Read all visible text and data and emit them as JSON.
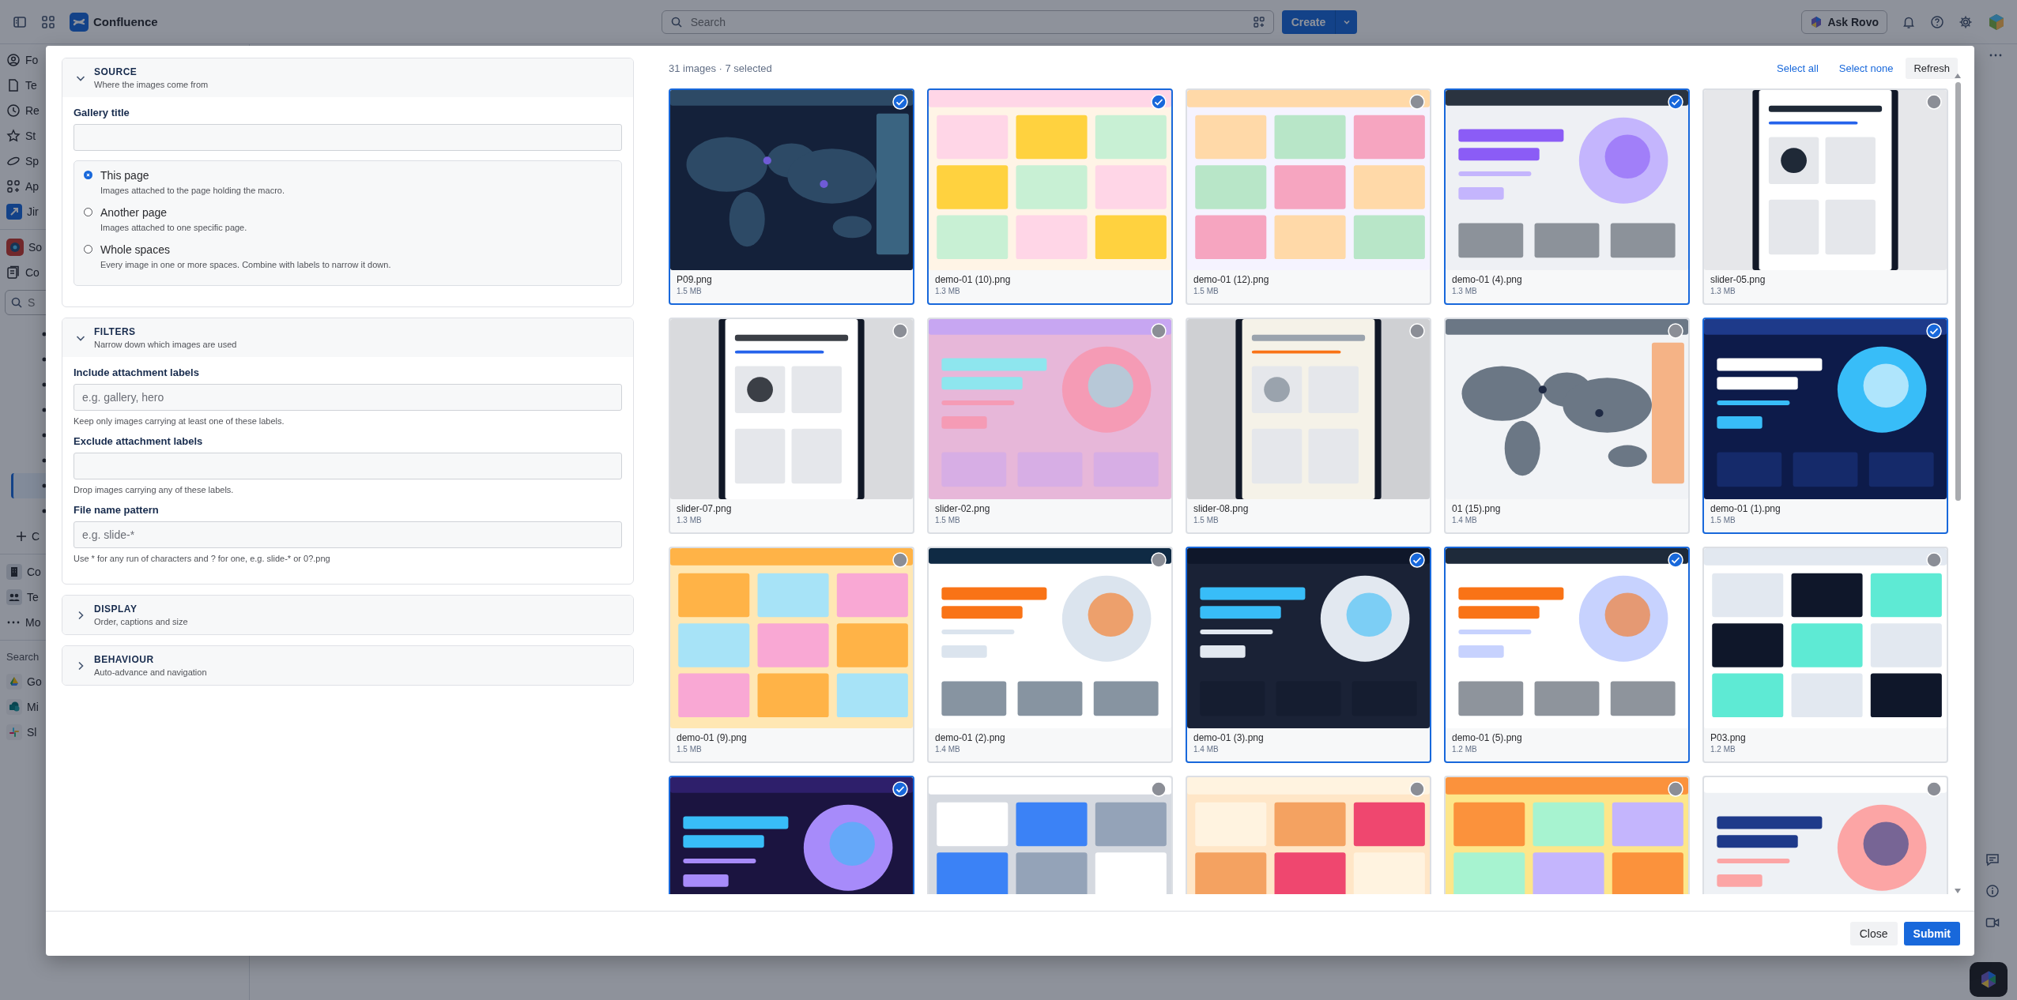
{
  "app": {
    "name": "Confluence"
  },
  "topbar": {
    "search_placeholder": "Search",
    "create_label": "Create",
    "rovo_label": "Ask Rovo"
  },
  "sidebar": {
    "nav": [
      {
        "label": "Fo"
      },
      {
        "label": "Te"
      },
      {
        "label": "Re"
      },
      {
        "label": "St"
      },
      {
        "label": "Sp"
      },
      {
        "label": "Ap"
      },
      {
        "label": "Jir"
      }
    ],
    "space": [
      {
        "label": "So"
      },
      {
        "label": "Co"
      }
    ],
    "search_placeholder": "S",
    "tree": [
      {
        "selected": false
      },
      {
        "selected": false
      },
      {
        "selected": false
      },
      {
        "selected": false
      },
      {
        "selected": false
      },
      {
        "selected": false
      },
      {
        "selected": true
      },
      {
        "selected": false
      }
    ],
    "tree_add": "C",
    "more": [
      {
        "label": "Co"
      },
      {
        "label": "Te"
      },
      {
        "label": "Mo"
      }
    ],
    "apps_heading": "Search",
    "apps": [
      {
        "label": "Go"
      },
      {
        "label": "Mi"
      },
      {
        "label": "Sl"
      }
    ]
  },
  "modal": {
    "sections": [
      {
        "title": "SOURCE",
        "subtitle": "Where the images come from",
        "expanded": true,
        "fields": [
          {
            "kind": "text",
            "label": "Gallery title"
          },
          {
            "kind": "radio",
            "options": [
              {
                "label": "This page",
                "description": "Images attached to the page holding the macro.",
                "selected": true
              },
              {
                "label": "Another page",
                "description": "Images attached to one specific page.",
                "selected": false
              },
              {
                "label": "Whole spaces",
                "description": "Every image in one or more spaces. Combine with labels to narrow it down.",
                "selected": false
              }
            ]
          }
        ]
      },
      {
        "title": "FILTERS",
        "subtitle": "Narrow down which images are used",
        "expanded": true,
        "fields": [
          {
            "kind": "text",
            "label": "Include attachment labels",
            "placeholder": "e.g. gallery, hero",
            "help": "Keep only images carrying at least one of these labels."
          },
          {
            "kind": "text",
            "label": "Exclude attachment labels",
            "help": "Drop images carrying any of these labels."
          },
          {
            "kind": "text",
            "label": "File name pattern",
            "placeholder": "e.g. slide-*",
            "help": "Use * for any run of characters and ? for one, e.g. slide-* or 0?.png"
          }
        ]
      },
      {
        "title": "DISPLAY",
        "subtitle": "Order, captions and size",
        "expanded": false
      },
      {
        "title": "BEHAVIOUR",
        "subtitle": "Auto-advance and navigation",
        "expanded": false
      }
    ],
    "gallery": {
      "summary": "31 images · 7 selected",
      "actions": [
        "Select all",
        "Select none"
      ],
      "refresh": "Refresh",
      "images": [
        {
          "kind": "picture",
          "name": "P09.png",
          "size": "1.5 MB",
          "selected": true
        },
        {
          "kind": "picture",
          "name": "demo-01 (10).png",
          "size": "1.3 MB",
          "selected": true
        },
        {
          "kind": "picture",
          "name": "demo-01 (12).png",
          "size": "1.5 MB",
          "selected": false
        },
        {
          "kind": "picture",
          "name": "demo-01 (4).png",
          "size": "1.3 MB",
          "selected": true
        },
        {
          "kind": "picture",
          "name": "slider-05.png",
          "size": "1.3 MB",
          "selected": false
        },
        {
          "kind": "picture",
          "name": "slider-07.png",
          "size": "1.3 MB",
          "selected": false
        },
        {
          "kind": "picture",
          "name": "slider-02.png",
          "size": "1.5 MB",
          "selected": false
        },
        {
          "kind": "picture",
          "name": "slider-08.png",
          "size": "1.5 MB",
          "selected": false
        },
        {
          "kind": "picture",
          "name": "01 (15).png",
          "size": "1.4 MB",
          "selected": false
        },
        {
          "kind": "picture",
          "name": "demo-01 (1).png",
          "size": "1.5 MB",
          "selected": true
        },
        {
          "kind": "picture",
          "name": "demo-01 (9).png",
          "size": "1.5 MB",
          "selected": false
        },
        {
          "kind": "picture",
          "name": "demo-01 (2).png",
          "size": "1.4 MB",
          "selected": false
        },
        {
          "kind": "picture",
          "name": "demo-01 (3).png",
          "size": "1.4 MB",
          "selected": true
        },
        {
          "kind": "picture",
          "name": "demo-01 (5).png",
          "size": "1.2 MB",
          "selected": true
        },
        {
          "kind": "picture",
          "name": "P03.png",
          "size": "1.2 MB",
          "selected": false
        },
        {
          "kind": "picture",
          "selected": true
        },
        {
          "kind": "picture",
          "selected": false
        },
        {
          "kind": "picture",
          "selected": false
        },
        {
          "kind": "picture",
          "selected": false
        },
        {
          "kind": "picture",
          "selected": false
        }
      ]
    },
    "buttons": [
      {
        "label": "Close",
        "primary": false
      },
      {
        "label": "Submit",
        "primary": true
      }
    ]
  }
}
